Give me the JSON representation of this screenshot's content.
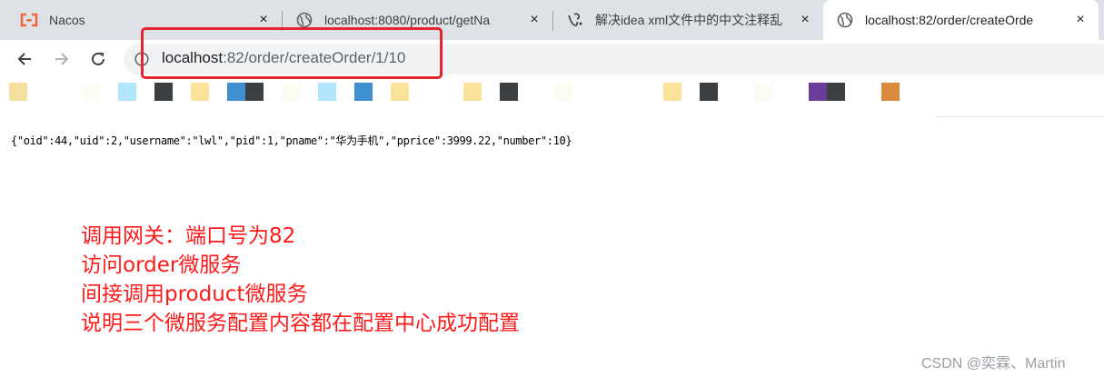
{
  "tabs": [
    {
      "title": "Nacos",
      "icon": "nacos-logo-icon",
      "close": "×"
    },
    {
      "title": "localhost:8080/product/getNa",
      "icon": "globe-icon",
      "close": "×"
    },
    {
      "title": "解决idea xml文件中的中文注释乱",
      "icon": "article-icon",
      "close": "×"
    },
    {
      "title": "localhost:82/order/createOrde",
      "icon": "globe-icon",
      "close": "×",
      "active": true
    }
  ],
  "address": {
    "host": "localhost",
    "path": ":82/order/createOrder/1/10"
  },
  "bookmarks": [
    {
      "color": "#f5e0a0"
    },
    {
      "color": "#fdfdf5"
    },
    {
      "color": "#b3e5fc"
    },
    {
      "color": "#3c4043"
    },
    {
      "color": "#fbe29a"
    },
    {
      "color": "#3f8fd2"
    },
    {
      "color": "#3c4043"
    },
    {
      "color": "#fcfcf2"
    },
    {
      "color": "#b3e5fc"
    },
    {
      "color": "#3f8fd2"
    },
    {
      "color": "#fbe29a"
    },
    {
      "color": "#fbe29a"
    },
    {
      "color": "#3c4043"
    },
    {
      "color": "#fcfcf2"
    },
    {
      "color": "#fbe29a"
    },
    {
      "color": "#3c4043"
    },
    {
      "color": "#fcfcf2"
    },
    {
      "color": "#6a3d9a"
    },
    {
      "color": "#3c4043"
    },
    {
      "color": "#d98a3c"
    }
  ],
  "response_json": "{\"oid\":44,\"uid\":2,\"username\":\"lwl\",\"pid\":1,\"pname\":\"华为手机\",\"pprice\":3999.22,\"number\":10}",
  "annotation": {
    "lines": [
      "调用网关：端口号为82",
      "访问order微服务",
      "间接调用product微服务",
      "说明三个微服务配置内容都在配置中心成功配置"
    ],
    "color": "#ff1a1a"
  },
  "watermark": "CSDN @奕霖、Martin",
  "colors": {
    "highlight_box": "#e3262d",
    "tab_strip": "#dee1e6",
    "omnibox": "#f1f3f4"
  }
}
